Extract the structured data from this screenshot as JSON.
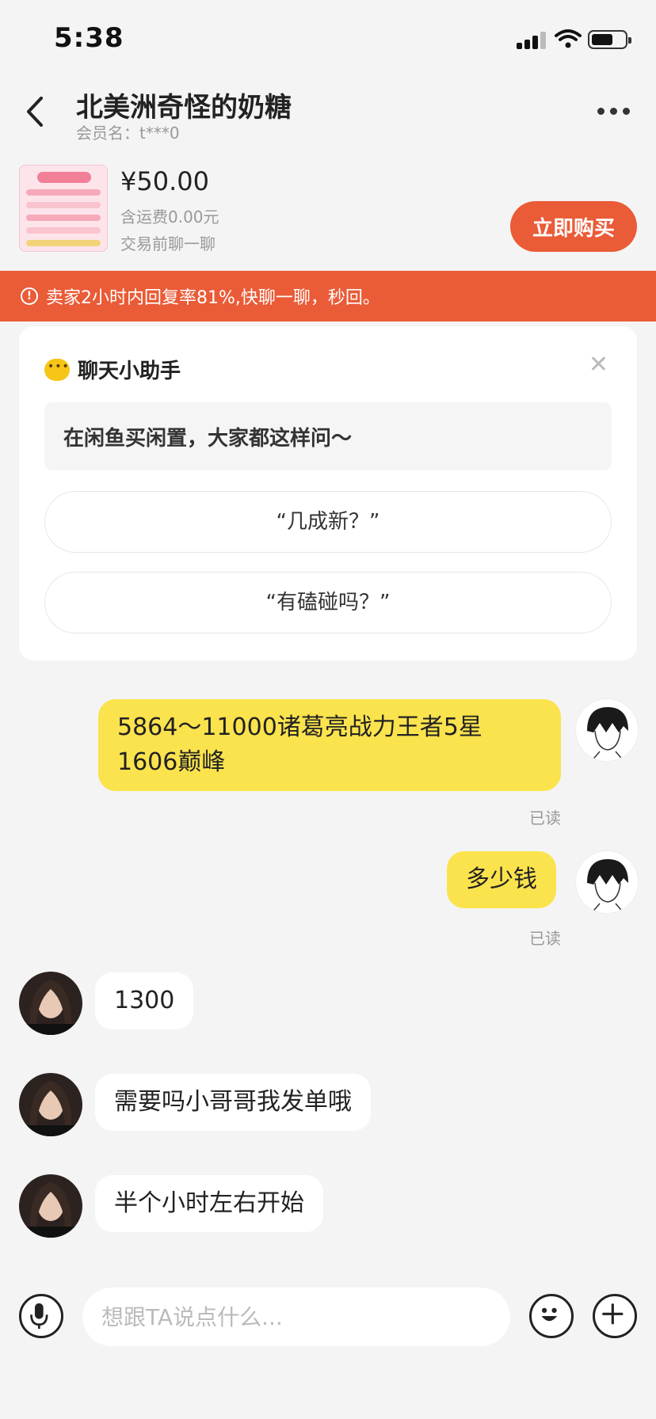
{
  "status_bar": {
    "time": "5:38"
  },
  "header": {
    "title": "北美洲奇怪的奶糖",
    "member_label": "会员名：t***0"
  },
  "product": {
    "price": "¥50.00",
    "shipping": "含运费0.00元",
    "chat_note": "交易前聊一聊",
    "buy_label": "立即购买"
  },
  "notice": {
    "text": "卖家2小时内回复率81%,快聊一聊，秒回。"
  },
  "assistant": {
    "title": "聊天小助手",
    "hint": "在闲鱼买闲置，大家都这样问～",
    "suggestions": [
      "“几成新？”",
      "“有磕碰吗？”"
    ]
  },
  "messages": [
    {
      "from": "me",
      "text": "5864～11000诸葛亮战力王者5星1606巅峰",
      "status": "已读"
    },
    {
      "from": "me",
      "text": "多少钱",
      "status": "已读"
    },
    {
      "from": "seller",
      "text": "1300"
    },
    {
      "from": "seller",
      "text": "需要吗小哥哥我发单哦"
    },
    {
      "from": "seller",
      "text": "半个小时左右开始"
    }
  ],
  "composer": {
    "placeholder": "想跟TA说点什么..."
  },
  "colors": {
    "accent": "#ea5b37",
    "my_bubble": "#fbe34e",
    "background": "#f4f4f4"
  }
}
